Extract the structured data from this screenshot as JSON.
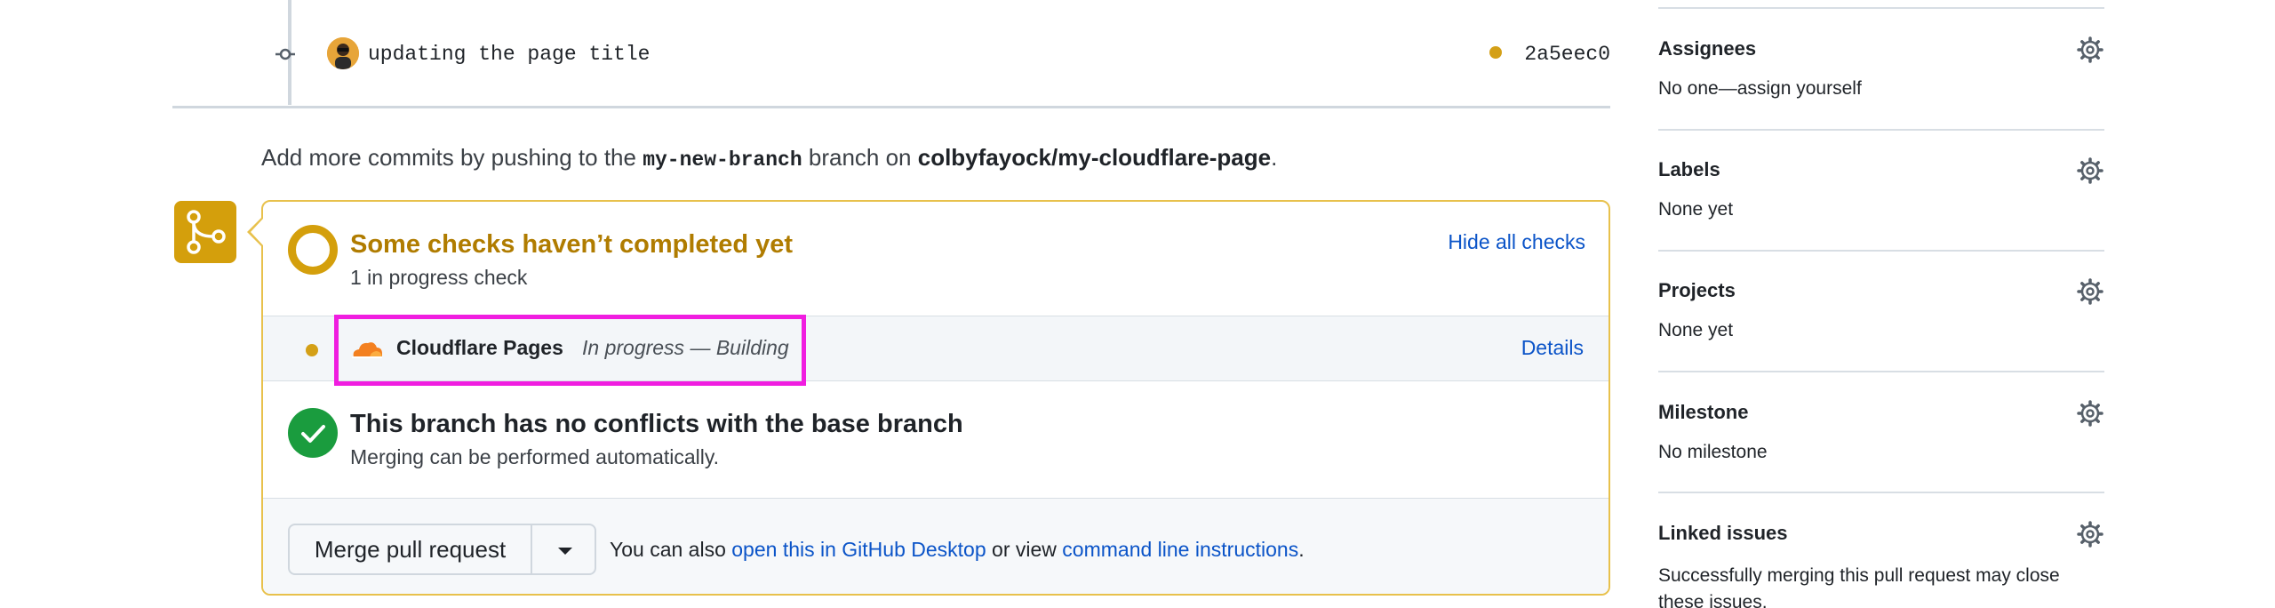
{
  "commit": {
    "message": "updating the page title",
    "sha": "2a5eec0",
    "status_color": "#d4a017"
  },
  "push_hint": {
    "prefix": "Add more commits by pushing to the ",
    "branch": "my-new-branch",
    "middle": " branch on ",
    "repo": "colbyfayock/my-cloudflare-page",
    "suffix": "."
  },
  "checks": {
    "title": "Some checks haven’t completed yet",
    "subtitle": "1 in progress check",
    "toggle_label": "Hide all checks",
    "items": [
      {
        "name": "Cloudflare Pages",
        "status": "In progress — Building",
        "details_label": "Details",
        "icon": "cloudflare-icon"
      }
    ]
  },
  "conflicts": {
    "title": "This branch has no conflicts with the base branch",
    "subtitle": "Merging can be performed automatically."
  },
  "merge": {
    "button_label": "Merge pull request",
    "note_prefix": "You can also ",
    "desktop_link": "open this in GitHub Desktop",
    "note_middle": " or view ",
    "cli_link": "command line instructions",
    "note_suffix": "."
  },
  "sidebar": {
    "assignees": {
      "title": "Assignees",
      "value": "No one—assign yourself"
    },
    "labels": {
      "title": "Labels",
      "value": "None yet"
    },
    "projects": {
      "title": "Projects",
      "value": "None yet"
    },
    "milestone": {
      "title": "Milestone",
      "value": "No milestone"
    },
    "linked_issues": {
      "title": "Linked issues",
      "value": "Successfully merging this pull request may close these issues."
    }
  },
  "colors": {
    "pending": "#d49f0c",
    "success": "#1a9c3e",
    "link": "#0b54c8",
    "highlight": "#f01de0"
  }
}
